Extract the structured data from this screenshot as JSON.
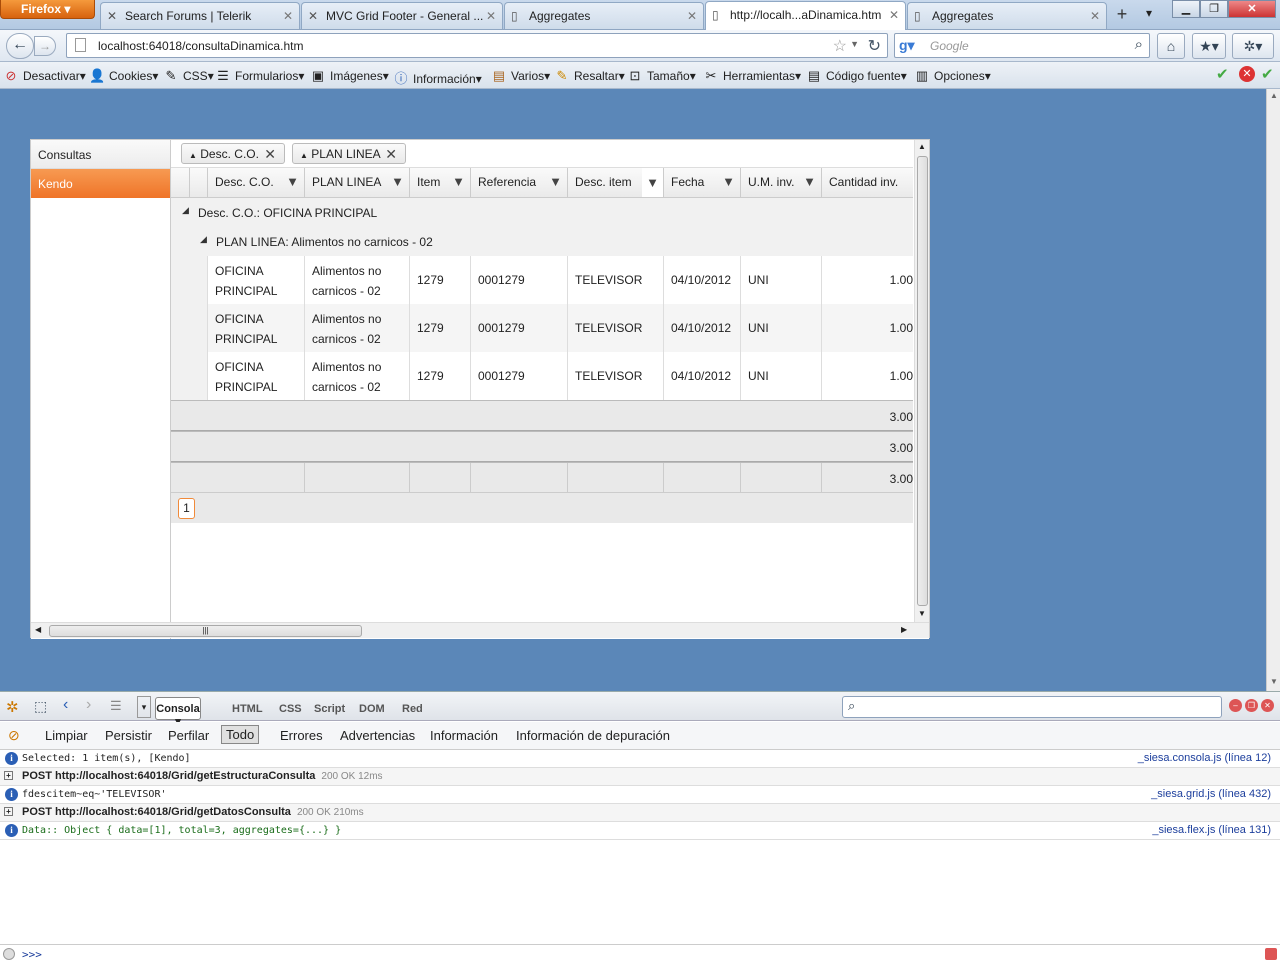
{
  "browser": {
    "menu_button": "Firefox",
    "tabs": [
      {
        "label": "Search Forums | Telerik",
        "icon": "telerik-icon"
      },
      {
        "label": "MVC Grid Footer - General ...",
        "icon": "telerik-icon"
      },
      {
        "label": "Aggregates",
        "icon": "page-icon"
      },
      {
        "label": "http://localh...aDinamica.htm",
        "icon": "page-icon",
        "active": true
      },
      {
        "label": "Aggregates",
        "icon": "page-icon"
      }
    ],
    "url": "localhost:64018/consultaDinamica.htm",
    "search_placeholder": "Google"
  },
  "webdev_toolbar": [
    "Desactivar",
    "Cookies",
    "CSS",
    "Formularios",
    "Imágenes",
    "Información",
    "Varios",
    "Resaltar",
    "Tamaño",
    "Herramientas",
    "Código fuente",
    "Opciones"
  ],
  "app": {
    "sidebar": [
      {
        "label": "Consultas",
        "selected": false
      },
      {
        "label": "Kendo",
        "selected": true
      }
    ],
    "grid": {
      "group_chips": [
        "Desc. C.O.",
        "PLAN LINEA"
      ],
      "columns": [
        "Desc. C.O.",
        "PLAN LINEA",
        "Item",
        "Referencia",
        "Desc. item",
        "Fecha",
        "U.M. inv.",
        "Cantidad inv."
      ],
      "group1": "Desc. C.O.: OFICINA PRINCIPAL",
      "group2": "PLAN LINEA: Alimentos no carnicos - 02",
      "rows": [
        {
          "desc_co": "OFICINA PRINCIPAL",
          "plan_linea": "Alimentos no carnicos - 02",
          "item": "1279",
          "referencia": "0001279",
          "desc_item": "TELEVISOR",
          "fecha": "04/10/2012",
          "um": "UNI",
          "cantidad": "1.00"
        },
        {
          "desc_co": "OFICINA PRINCIPAL",
          "plan_linea": "Alimentos no carnicos - 02",
          "item": "1279",
          "referencia": "0001279",
          "desc_item": "TELEVISOR",
          "fecha": "04/10/2012",
          "um": "UNI",
          "cantidad": "1.00"
        },
        {
          "desc_co": "OFICINA PRINCIPAL",
          "plan_linea": "Alimentos no carnicos - 02",
          "item": "1279",
          "referencia": "0001279",
          "desc_item": "TELEVISOR",
          "fecha": "04/10/2012",
          "um": "UNI",
          "cantidad": "1.00"
        }
      ],
      "footer_totals": [
        "3.00",
        "3.00",
        "3.00"
      ],
      "page": "1"
    }
  },
  "firebug": {
    "panel_tabs": [
      "Consola",
      "HTML",
      "CSS",
      "Script",
      "DOM",
      "Red"
    ],
    "sub_tabs": [
      "Limpiar",
      "Persistir",
      "Perfilar",
      "Todo",
      "Errores",
      "Advertencias",
      "Información",
      "Información de depuración"
    ],
    "logs": [
      {
        "kind": "info",
        "text": "Selected: 1 item(s), [Kendo]",
        "source": "_siesa.consola.js (línea 12)"
      },
      {
        "kind": "post",
        "text": "POST http://localhost:64018/Grid/getEstructuraConsulta",
        "status": "200 OK 12ms"
      },
      {
        "kind": "info",
        "text": "fdescitem~eq~'TELEVISOR'",
        "source": "_siesa.grid.js (línea 432)"
      },
      {
        "kind": "post",
        "text": "POST http://localhost:64018/Grid/getDatosConsulta",
        "status": "200 OK 210ms"
      },
      {
        "kind": "info",
        "text": "Data:: Object { data=[1], total=3, aggregates={...} }",
        "source": "_siesa.flex.js (línea 131)"
      }
    ],
    "prompt": ">>>"
  },
  "colors": {
    "page_bg": "#5b87b8",
    "kendo_accent": "#f07a2a"
  }
}
